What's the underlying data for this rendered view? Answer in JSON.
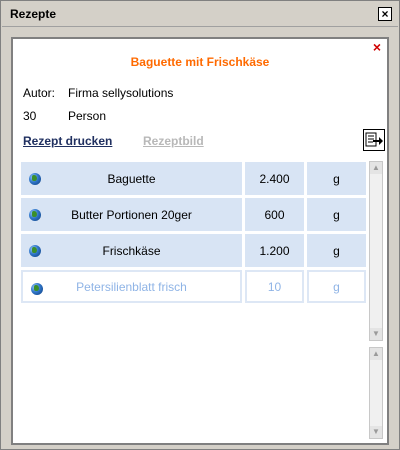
{
  "window": {
    "title": "Rezepte",
    "close_glyph": "×"
  },
  "panel": {
    "close_glyph": "×"
  },
  "recipe": {
    "title": "Baguette mit Frischkäse",
    "author_label": "Autor:",
    "author_value": "Firma sellysolutions",
    "servings_count": "30",
    "servings_unit": "Person"
  },
  "actions": {
    "print_label": "Rezept drucken",
    "image_label": "Rezeptbild"
  },
  "ingredients": [
    {
      "name": "Baguette",
      "quantity": "2.400",
      "unit": "g",
      "icon": "globe-icon"
    },
    {
      "name": "Butter Portionen 20ger",
      "quantity": "600",
      "unit": "g",
      "icon": "globe-icon"
    },
    {
      "name": "Frischkäse",
      "quantity": "1.200",
      "unit": "g",
      "icon": "globe-icon"
    },
    {
      "name": "Petersilienblatt frisch",
      "quantity": "10",
      "unit": "g",
      "icon": "globe-icon"
    }
  ],
  "colors": {
    "title_accent": "#ff6a00",
    "row_background": "#d8e4f4",
    "faded_text": "#8fb4e6",
    "close_red": "#d00000",
    "print_link": "#203060",
    "disabled_link": "#b8b8b8"
  },
  "icons": {
    "window_close": "close-icon",
    "panel_close": "close-icon",
    "export": "export-icon",
    "scroll_up": "scroll-up-arrow-icon",
    "scroll_down": "scroll-down-arrow-icon"
  }
}
